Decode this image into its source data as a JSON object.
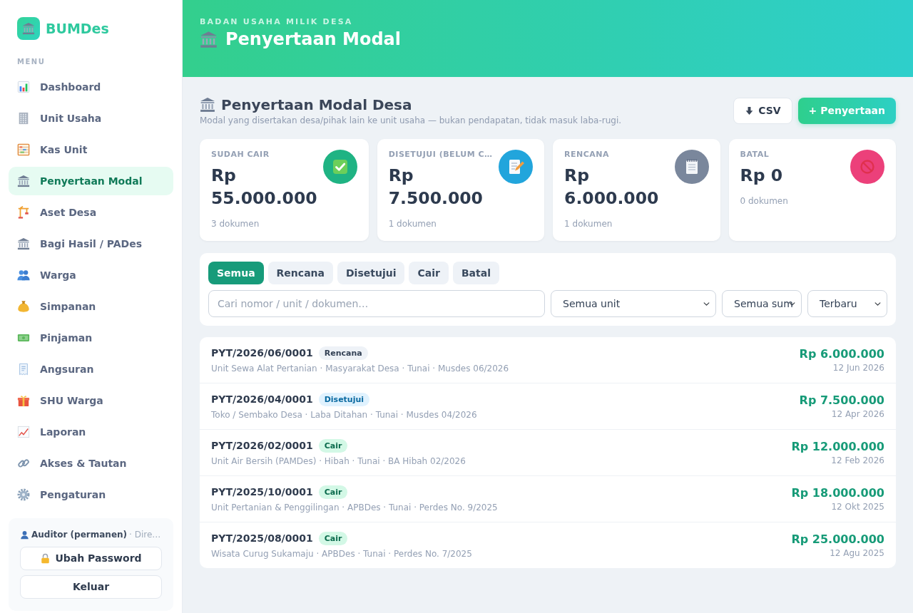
{
  "sidebar": {
    "brand": "BUMDes",
    "menu_label": "MENU",
    "items": [
      {
        "label": "Dashboard",
        "selected": false
      },
      {
        "label": "Unit Usaha",
        "selected": false
      },
      {
        "label": "Kas Unit",
        "selected": false
      },
      {
        "label": "Penyertaan Modal",
        "selected": true
      },
      {
        "label": "Aset Desa",
        "selected": false
      },
      {
        "label": "Bagi Hasil / PADes",
        "selected": false
      },
      {
        "label": "Warga",
        "selected": false
      },
      {
        "label": "Simpanan",
        "selected": false
      },
      {
        "label": "Pinjaman",
        "selected": false
      },
      {
        "label": "Angsuran",
        "selected": false
      },
      {
        "label": "SHU Warga",
        "selected": false
      },
      {
        "label": "Laporan",
        "selected": false
      },
      {
        "label": "Akses & Tautan",
        "selected": false
      },
      {
        "label": "Pengaturan",
        "selected": false
      }
    ],
    "user": {
      "name": "Auditor (permanen)",
      "role": "· Dire…"
    },
    "password_button": "Ubah Password",
    "logout_button": "Keluar"
  },
  "header": {
    "eyebrow": "BADAN USAHA MILIK DESA",
    "title": "Penyertaan Modal"
  },
  "section": {
    "title": "Penyertaan Modal Desa",
    "subtitle": "Modal yang disertakan desa/pihak lain ke unit usaha — bukan pendapatan, tidak masuk laba-rugi.",
    "export_button": "CSV",
    "add_button": "+ Penyertaan"
  },
  "stats": [
    {
      "label": "SUDAH CAIR",
      "value": "Rp 55.000.000",
      "note": "3 dokumen",
      "color": "#1fb383"
    },
    {
      "label": "DISETUJUI (BELUM C…",
      "value": "Rp 7.500.000",
      "note": "1 dokumen",
      "color": "#22a5dc"
    },
    {
      "label": "RENCANA",
      "value": "Rp 6.000.000",
      "note": "1 dokumen",
      "color": "#7a879c"
    },
    {
      "label": "BATAL",
      "value": "Rp 0",
      "note": "0 dokumen",
      "color": "#ec407a"
    }
  ],
  "filters": {
    "tabs": [
      {
        "label": "Semua",
        "selected": true
      },
      {
        "label": "Rencana",
        "selected": false
      },
      {
        "label": "Disetujui",
        "selected": false
      },
      {
        "label": "Cair",
        "selected": false
      },
      {
        "label": "Batal",
        "selected": false
      }
    ],
    "search": {
      "placeholder": "Cari nomor / unit / dokumen…"
    },
    "dropdowns": [
      "Semua unit",
      "Semua sum",
      "Terbaru"
    ]
  },
  "records": [
    {
      "number": "PYT/2026/06/0001",
      "status": "Rencana",
      "kind": "rencana",
      "details": "Unit Sewa Alat Pertanian · Masyarakat Desa · Tunai · Musdes 06/2026",
      "amount": "Rp 6.000.000",
      "date": "12 Jun 2026"
    },
    {
      "number": "PYT/2026/04/0001",
      "status": "Disetujui",
      "kind": "disetujui",
      "details": "Toko / Sembako Desa · Laba Ditahan · Tunai · Musdes 04/2026",
      "amount": "Rp 7.500.000",
      "date": "12 Apr 2026"
    },
    {
      "number": "PYT/2026/02/0001",
      "status": "Cair",
      "kind": "cair",
      "details": "Unit Air Bersih (PAMDes) · Hibah · Tunai · BA Hibah 02/2026",
      "amount": "Rp 12.000.000",
      "date": "12 Feb 2026"
    },
    {
      "number": "PYT/2025/10/0001",
      "status": "Cair",
      "kind": "cair",
      "details": "Unit Pertanian & Penggilingan · APBDes · Tunai · Perdes No. 9/2025",
      "amount": "Rp 18.000.000",
      "date": "12 Okt 2025"
    },
    {
      "number": "PYT/2025/08/0001",
      "status": "Cair",
      "kind": "cair",
      "details": "Wisata Curug Sukamaju · APBDes · Tunai · Perdes No. 7/2025",
      "amount": "Rp 25.000.000",
      "date": "12 Agu 2025"
    }
  ]
}
